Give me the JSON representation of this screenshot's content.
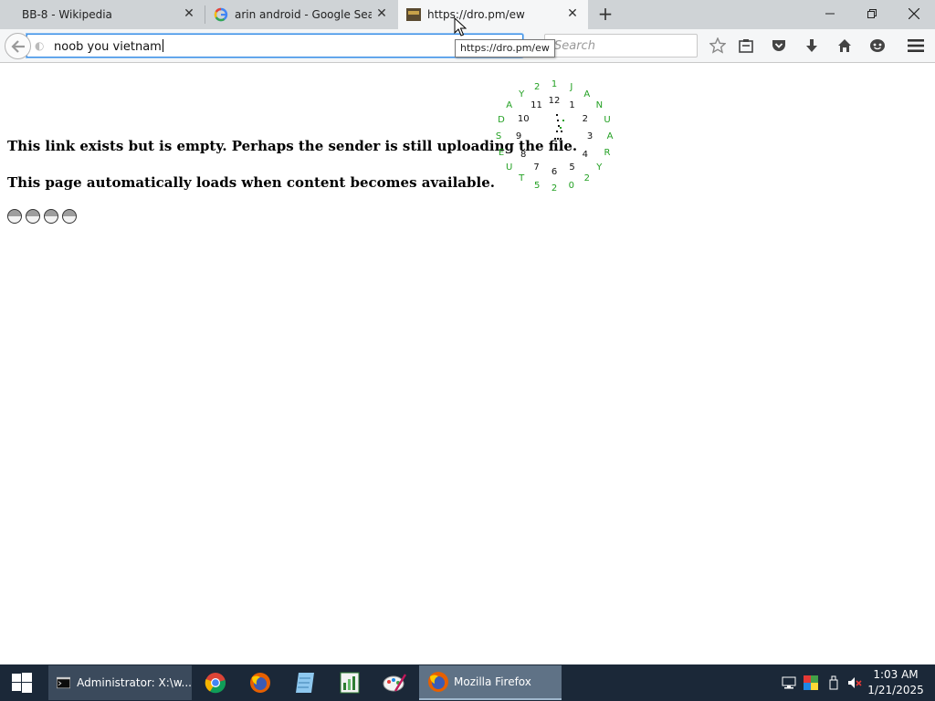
{
  "tabs": [
    {
      "title": "BB-8 - Wikipedia",
      "active": false
    },
    {
      "title": "arin android - Google Sear...",
      "active": false
    },
    {
      "title": "https://dro.pm/ew",
      "active": true
    }
  ],
  "urlbar": {
    "value": "noob you vietnam"
  },
  "search": {
    "placeholder": "Search"
  },
  "tooltip": "https://dro.pm/ew",
  "content": {
    "line1": "This link exists but is empty. Perhaps the sender is still uploading the file.",
    "line2": "This page automatically loads when content becomes available.",
    "loader_count": 4
  },
  "clock_widget": {
    "dial_numbers": [
      "12",
      "1",
      "2",
      "3",
      "4",
      "5",
      "6",
      "7",
      "8",
      "9",
      "10",
      "11"
    ],
    "date_ring": [
      "J",
      "A",
      "N",
      "U",
      "A",
      "R",
      "Y",
      "2",
      "0",
      "2",
      "5",
      "T",
      "U",
      "E",
      "S",
      "D",
      "A",
      "Y",
      "2",
      "1"
    ]
  },
  "taskbar": {
    "items": [
      {
        "label": "Administrator: X:\\w...",
        "icon": "terminal-icon"
      },
      {
        "label": "",
        "icon": "chrome-icon"
      },
      {
        "label": "",
        "icon": "firefox-icon"
      },
      {
        "label": "",
        "icon": "notepad-icon"
      },
      {
        "label": "",
        "icon": "spreadsheet-icon"
      },
      {
        "label": "",
        "icon": "paint-icon"
      },
      {
        "label": "Mozilla Firefox",
        "icon": "firefox-icon"
      }
    ],
    "time": "1:03 AM",
    "date": "1/21/2025"
  },
  "colors": {
    "accent": "#3a8ee6",
    "taskbar": "#1b2838",
    "date_ring": "#22a022"
  }
}
